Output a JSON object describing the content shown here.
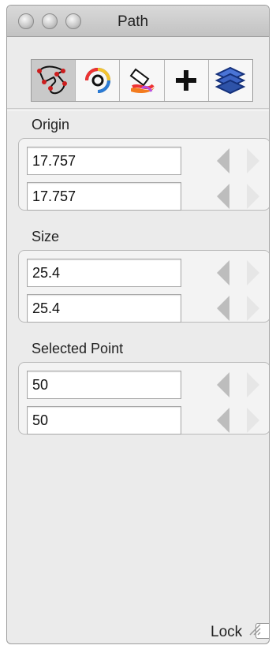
{
  "window": {
    "title": "Path"
  },
  "toolbar": {
    "tools": [
      {
        "icon": "path-select-icon",
        "active": true
      },
      {
        "icon": "color-wheel-icon",
        "active": false
      },
      {
        "icon": "paint-bucket-icon",
        "active": false
      },
      {
        "icon": "plus-icon",
        "active": false
      },
      {
        "icon": "layers-icon",
        "active": false
      }
    ]
  },
  "groups": {
    "origin": {
      "label": "Origin",
      "x": "17.757",
      "y": "17.757"
    },
    "size": {
      "label": "Size",
      "width": "25.4",
      "height": "25.4"
    },
    "selected_point": {
      "label": "Selected Point",
      "x": "50",
      "y": "50"
    }
  },
  "lock": {
    "label": "Lock",
    "checked": false
  }
}
